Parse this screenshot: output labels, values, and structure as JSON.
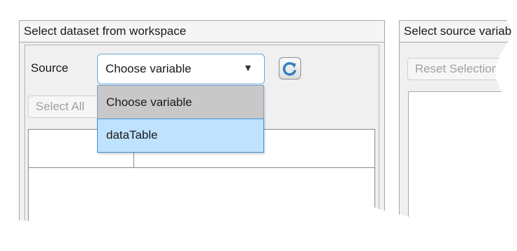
{
  "left_panel": {
    "title": "Select dataset from workspace",
    "source_label": "Source",
    "dropdown": {
      "value": "Choose variable",
      "options": [
        "Choose variable",
        "dataTable"
      ]
    },
    "refresh_icon": "refresh-icon",
    "select_all_label": "Select All"
  },
  "right_panel": {
    "title": "Select source variables",
    "reset_label": "Reset Selection"
  },
  "colors": {
    "panel_bg": "#f0f0f0",
    "dropdown_border": "#6aa7d6",
    "menu_highlight": "#bfe2ff",
    "menu_selected": "#c8c8c8",
    "refresh_icon": "#2f7fc1"
  }
}
